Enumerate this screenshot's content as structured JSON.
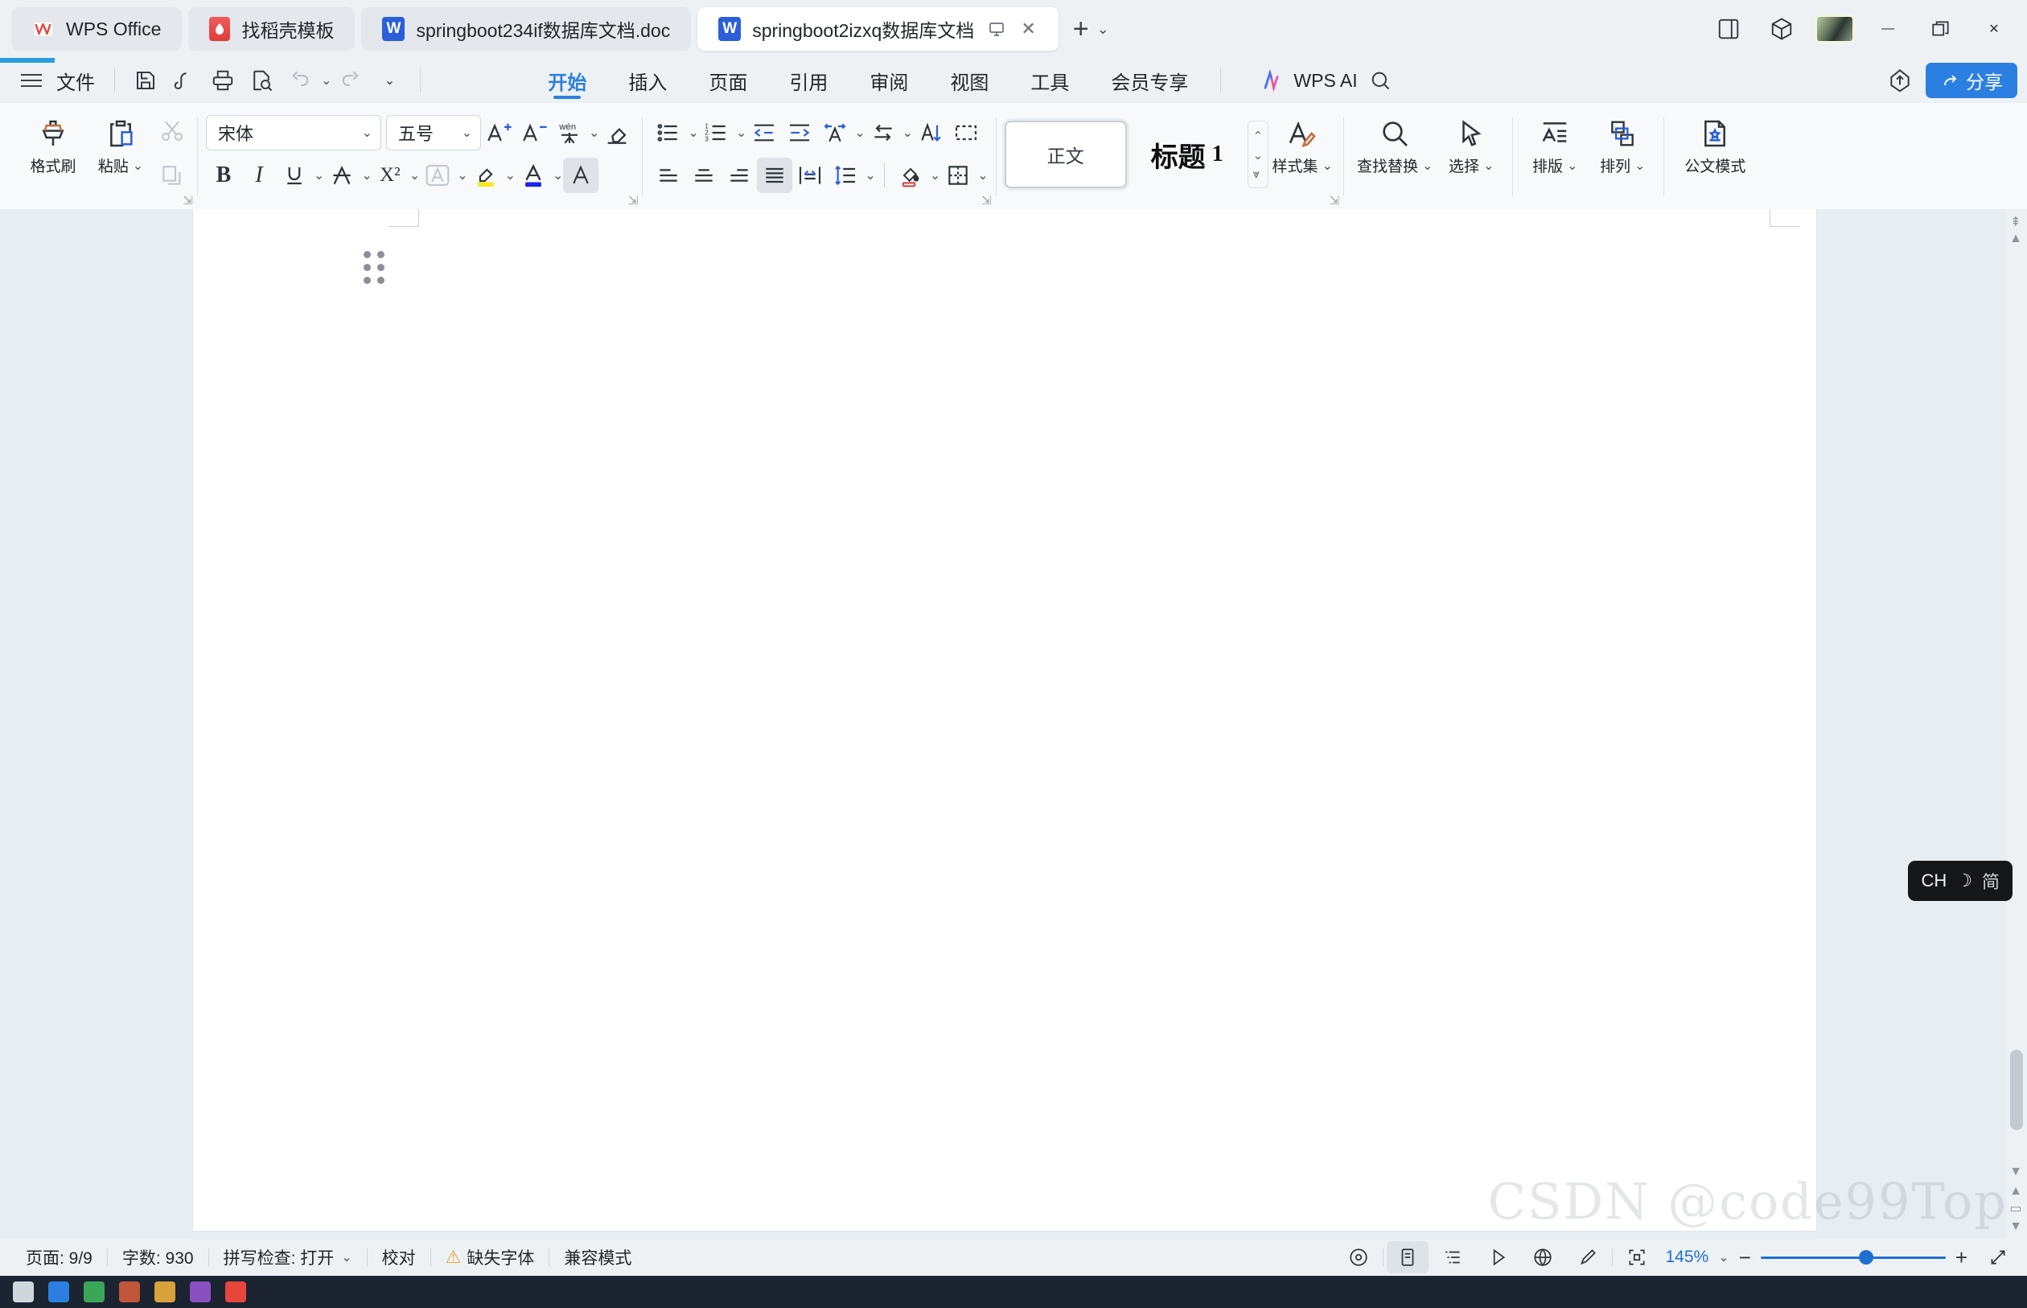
{
  "window": {
    "tabs": [
      {
        "label": "WPS Office",
        "icon": "wps-logo-icon",
        "state": "soft"
      },
      {
        "label": "找稻壳模板",
        "icon": "daoke-logo-icon",
        "state": "soft"
      },
      {
        "label": "springboot234if数据库文档.doc",
        "icon": "word-doc-icon",
        "state": "soft"
      },
      {
        "label": "springboot2izxq数据库文档",
        "icon": "word-doc-icon",
        "state": "active"
      }
    ],
    "new_tab_label": "+",
    "tab_list_caret": "⌄",
    "restore_icon": "restore-window-icon",
    "close_tab_icon": "✕",
    "controls": {
      "apps_icon": "app-grid-icon",
      "box_icon": "cube-icon",
      "avatar": "user-avatar",
      "minimize": "—",
      "maximize": "maximize-icon",
      "close": "✕"
    }
  },
  "menubar": {
    "hamburger": "menu-icon",
    "file_label": "文件",
    "quick_access": [
      {
        "name": "save-icon",
        "disabled": false
      },
      {
        "name": "cloud-sync-icon",
        "disabled": false
      },
      {
        "name": "print-icon",
        "disabled": false
      },
      {
        "name": "print-preview-icon",
        "disabled": false
      },
      {
        "name": "undo-icon",
        "disabled": true
      },
      {
        "name": "redo-icon",
        "disabled": true
      },
      {
        "name": "customize-caret-icon",
        "disabled": false
      }
    ],
    "tabs": [
      {
        "label": "开始",
        "active": true
      },
      {
        "label": "插入",
        "active": false
      },
      {
        "label": "页面",
        "active": false
      },
      {
        "label": "引用",
        "active": false
      },
      {
        "label": "审阅",
        "active": false
      },
      {
        "label": "视图",
        "active": false
      },
      {
        "label": "工具",
        "active": false
      },
      {
        "label": "会员专享",
        "active": false
      }
    ],
    "ai_label": "WPS AI",
    "search_icon": "search-icon",
    "upload_icon": "upload-cloud-icon",
    "share_label": "分享",
    "share_color": "#2b7fe0"
  },
  "ribbon": {
    "clipboard": {
      "format_painter": "格式刷",
      "paste": "粘贴",
      "cut_icon": "scissors-icon",
      "copy_icon": "copy-icon"
    },
    "font": {
      "family_value": "宋体",
      "size_value": "五号",
      "grow_icon": "increase-font-size-icon",
      "shrink_icon": "decrease-font-size-icon",
      "pinyin_icon": "pinyin-guide-icon",
      "clear_format_icon": "clear-formatting-icon",
      "bold": "B",
      "italic": "I",
      "underline": "U",
      "strikethrough_icon": "strikethrough-icon",
      "superscript": "X²",
      "border_char_icon": "enclose-character-icon",
      "highlight_icon": "text-highlight-icon",
      "highlight_color": "#f7e81e",
      "font_color_icon": "font-color-icon",
      "font_color": "#1b23e8",
      "text_effect_icon": "text-effect-icon"
    },
    "paragraph": {
      "bullets_icon": "bulleted-list-icon",
      "numbering_icon": "numbered-list-icon",
      "decrease_indent_icon": "decrease-indent-icon",
      "increase_indent_icon": "increase-indent-icon",
      "align_asian_icon": "asian-layout-icon",
      "ltr_rtl_icon": "text-direction-icon",
      "sort_icon": "sort-icon",
      "show_marks_icon": "show-formatting-marks-icon",
      "align_left_icon": "align-left-icon",
      "align_center_icon": "align-center-icon",
      "align_right_icon": "align-right-icon",
      "align_justify_icon": "align-justify-icon",
      "distribute_icon": "distribute-text-icon",
      "line_spacing_icon": "line-spacing-icon",
      "shading_icon": "paragraph-shading-icon",
      "borders_icon": "borders-icon"
    },
    "styles": {
      "normal_label": "正文",
      "heading_label": "标题",
      "heading_number": "1",
      "scroll_up": "⌃",
      "scroll_down": "⌄",
      "more_styles": "⩔",
      "style_set_label": "样式集",
      "style_set_icon": "style-set-icon"
    },
    "editing": {
      "find_replace_label": "查找替换",
      "find_replace_icon": "search-icon",
      "select_label": "选择",
      "select_icon": "cursor-select-icon"
    },
    "layout": {
      "typeset_label": "排版",
      "typeset_icon": "typeset-icon",
      "arrange_label": "排列",
      "arrange_icon": "arrange-objects-icon",
      "official_doc_label": "公文模式",
      "official_doc_icon": "official-document-icon"
    }
  },
  "document": {
    "drag_handle_icon": "paragraph-drag-handle-icon",
    "page_blank": true
  },
  "ime": {
    "language": "CH",
    "mode_icon": "moon-icon",
    "script": "简"
  },
  "watermark": "CSDN @code99Top",
  "statusbar": {
    "page_label": "页面: 9/9",
    "word_count_label": "字数: 930",
    "spellcheck_label": "拼写检查: 打开",
    "proofread_label": "校对",
    "missing_font_label": "缺失字体",
    "missing_font_icon": "warning-icon",
    "compat_label": "兼容模式",
    "view_icons": [
      {
        "name": "focus-view-icon",
        "selected": false
      },
      {
        "name": "page-view-icon",
        "selected": true
      },
      {
        "name": "outline-view-icon",
        "selected": false
      },
      {
        "name": "presentation-view-icon",
        "selected": false
      },
      {
        "name": "web-view-icon",
        "selected": false
      },
      {
        "name": "ink-annotation-icon",
        "selected": false
      },
      {
        "name": "fullscreen-icon",
        "selected": false
      }
    ],
    "zoom_value": "145%",
    "zoom_caret": "⌄",
    "zoom_minus": "−",
    "zoom_plus": "+",
    "fit_page_icon": "fit-page-icon"
  }
}
